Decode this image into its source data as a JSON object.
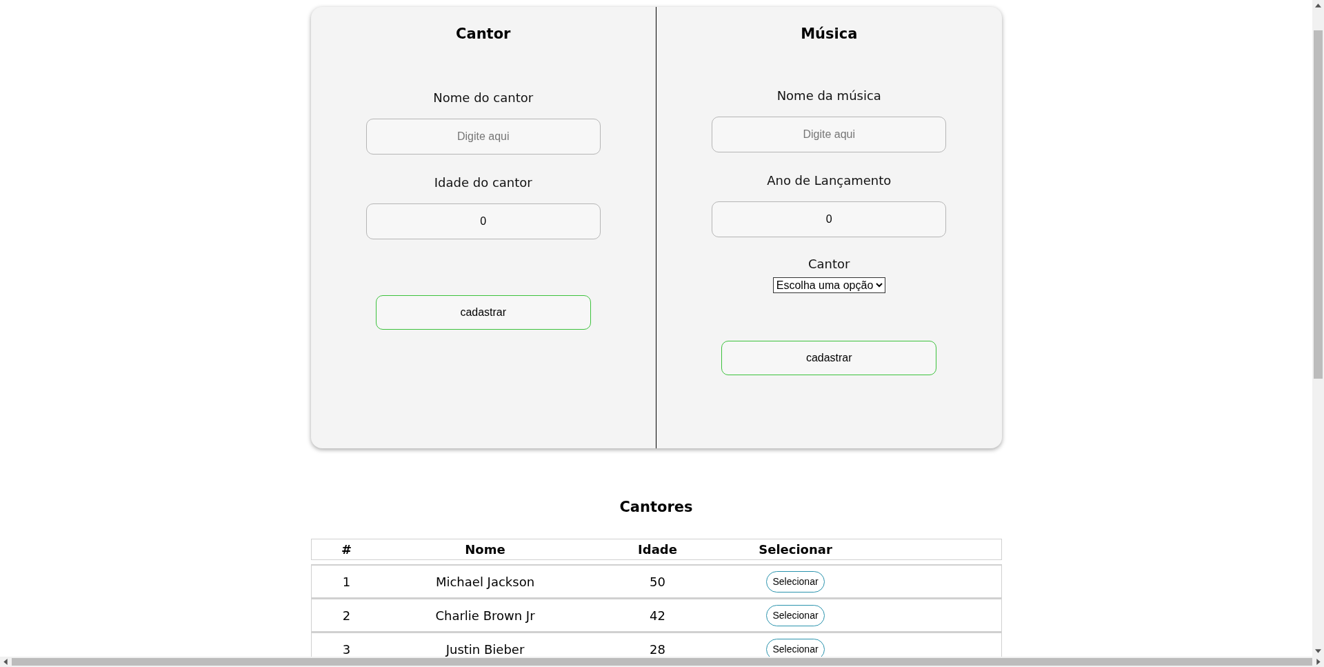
{
  "cantor_form": {
    "title": "Cantor",
    "fields": [
      {
        "label": "Nome do cantor",
        "placeholder": "Digite aqui"
      },
      {
        "label": "Idade do cantor",
        "value": "0"
      }
    ],
    "submit": "cadastrar"
  },
  "musica_form": {
    "title": "Música",
    "fields": [
      {
        "label": "Nome da música",
        "placeholder": "Digite aqui"
      },
      {
        "label": "Ano de Lançamento",
        "value": "0"
      }
    ],
    "select": {
      "label": "Cantor",
      "value": "Escolha uma opção"
    },
    "submit": "cadastrar"
  },
  "cantores": {
    "title": "Cantores",
    "columns": [
      "#",
      "Nome",
      "Idade",
      "Selecionar"
    ],
    "rows": [
      {
        "id": "1",
        "nome": "Michael Jackson",
        "idade": "50",
        "action": "Selecionar"
      },
      {
        "id": "2",
        "nome": "Charlie Brown Jr",
        "idade": "42",
        "action": "Selecionar"
      },
      {
        "id": "3",
        "nome": "Justin Bieber",
        "idade": "28",
        "action": "Selecionar"
      }
    ]
  }
}
